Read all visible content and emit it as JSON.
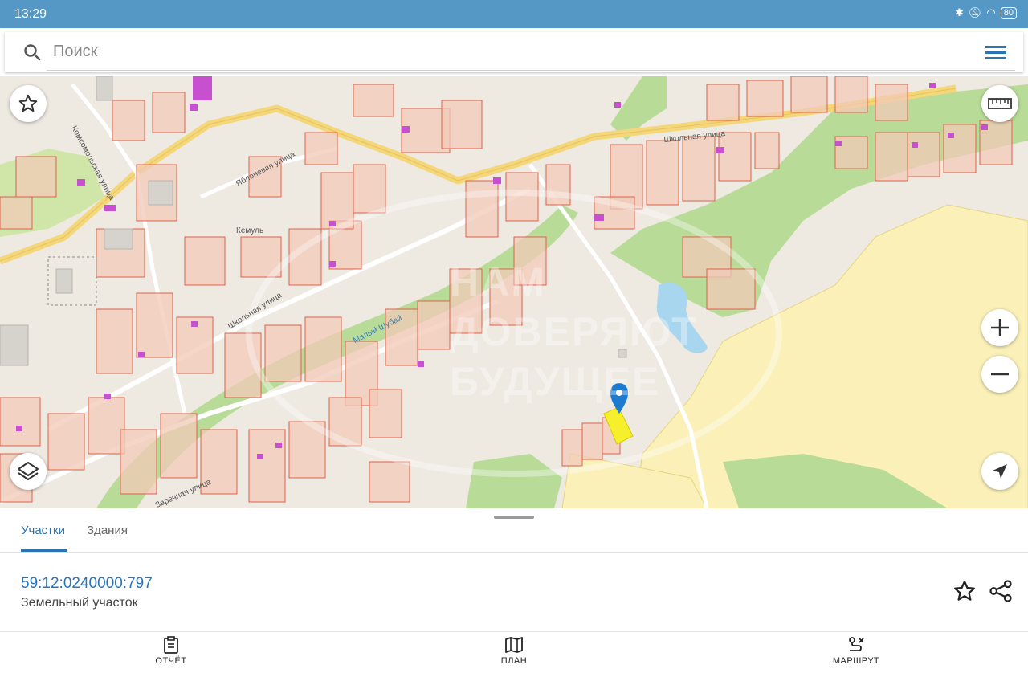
{
  "status_bar": {
    "time": "13:29",
    "battery": "80"
  },
  "search": {
    "placeholder": "Поиск"
  },
  "map": {
    "place_labels": [
      "Кемуль"
    ],
    "street_labels": [
      "Комсомольская улица",
      "Яблоневая улица",
      "Школьная улица",
      "Школьная улица",
      "Заречная улица",
      "Малый Шубай"
    ],
    "watermark": [
      "НАМ",
      "ДОВЕРЯЮТ",
      "БУДУЩЕЕ"
    ],
    "colors": {
      "parcel_fill": "#f2c9b8",
      "parcel_stroke": "#e0614a",
      "road": "#f3d77a",
      "forest": "#b8dc98",
      "field": "#faf0b8",
      "water": "#a9d6ef",
      "selected_parcel": "#f6ef2b",
      "marker": "#1c7ad1",
      "building": "#c84fd0"
    }
  },
  "controls": {
    "favorite_icon": "star-outline-icon",
    "ruler_icon": "ruler-icon",
    "zoom_in_icon": "plus-icon",
    "zoom_out_icon": "minus-icon",
    "layers_icon": "layers-icon",
    "locate_icon": "navigation-arrow-icon"
  },
  "panel": {
    "tabs": [
      {
        "label": "Участки",
        "active": true
      },
      {
        "label": "Здания",
        "active": false
      }
    ],
    "parcel": {
      "cadastral_number": "59:12:0240000:797",
      "type": "Земельный участок"
    }
  },
  "bottom_nav": [
    {
      "label": "ОТЧЁТ",
      "icon": "clipboard-icon"
    },
    {
      "label": "ПЛАН",
      "icon": "map-icon"
    },
    {
      "label": "МАРШРУТ",
      "icon": "route-icon"
    }
  ],
  "accent_color": "#2a73b5",
  "statusbar_color": "#5598c6"
}
